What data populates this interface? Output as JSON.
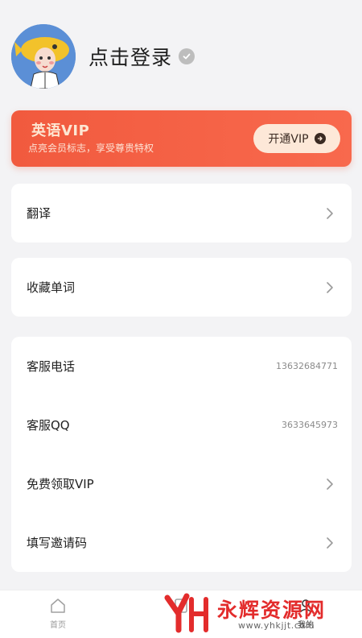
{
  "profile": {
    "login_text": "点击登录",
    "avatar_icon": "cartoon-avatar",
    "verify_icon": "check-circle-icon"
  },
  "vip_banner": {
    "title": "英语VIP",
    "subtitle": "点亮会员标志，享受尊贵特权",
    "button_label": "开通VIP",
    "accent": "#f15a3e"
  },
  "menu_groups": [
    {
      "items": [
        {
          "label": "翻译",
          "chevron": true
        }
      ]
    },
    {
      "items": [
        {
          "label": "收藏单词",
          "chevron": true
        }
      ]
    },
    {
      "items": [
        {
          "label": "客服电话",
          "value": "13632684771"
        },
        {
          "label": "客服QQ",
          "value": "3633645973"
        },
        {
          "label": "免费领取VIP",
          "chevron": true
        },
        {
          "label": "填写邀请码",
          "chevron": true
        }
      ]
    }
  ],
  "tabbar": {
    "tabs": [
      {
        "label": "首页",
        "icon": "home-icon"
      },
      {
        "label": "",
        "icon": "book-icon"
      },
      {
        "label": "我的",
        "icon": "user-icon"
      }
    ]
  },
  "watermark": {
    "text": "永辉资源网",
    "url": "www.yhkjjt.com"
  }
}
